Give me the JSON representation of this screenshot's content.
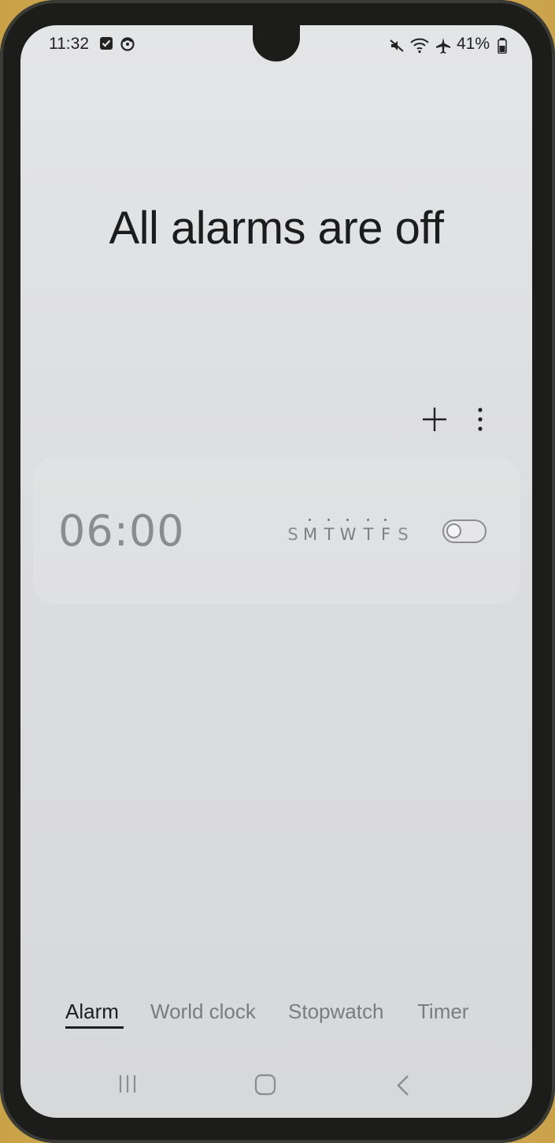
{
  "status_bar": {
    "time": "11:32",
    "battery": "41%",
    "left_icons": [
      "checkbox-notification-icon",
      "timer-notification-icon"
    ],
    "right_icons": [
      "mute-icon",
      "wifi-icon",
      "airplane-icon",
      "battery-icon"
    ]
  },
  "header": {
    "title": "All alarms are off"
  },
  "actions": {
    "add_icon": "plus-icon",
    "more_icon": "more-vertical-icon"
  },
  "alarm": {
    "time": "06:00",
    "days": [
      {
        "letter": "S",
        "active": false
      },
      {
        "letter": "M",
        "active": true
      },
      {
        "letter": "T",
        "active": true
      },
      {
        "letter": "W",
        "active": true
      },
      {
        "letter": "T",
        "active": true
      },
      {
        "letter": "F",
        "active": true
      },
      {
        "letter": "S",
        "active": false
      }
    ],
    "enabled": false
  },
  "tabs": [
    {
      "label": "Alarm",
      "active": true
    },
    {
      "label": "World clock",
      "active": false
    },
    {
      "label": "Stopwatch",
      "active": false
    },
    {
      "label": "Timer",
      "active": false
    }
  ],
  "nav": [
    "recent-apps-icon",
    "home-icon",
    "back-icon"
  ]
}
